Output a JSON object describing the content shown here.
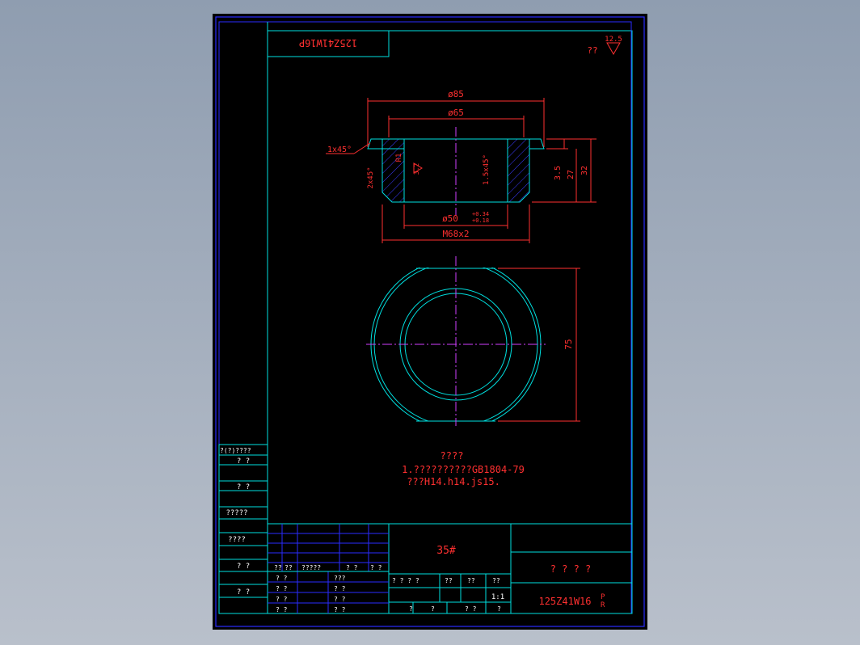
{
  "drawing_code_rotated": "125Z41W16P",
  "roughness": {
    "value": "12.5",
    "note": "??"
  },
  "dims": {
    "d85": "ø85",
    "d65": "ø65",
    "chamfer_top": "1x45°",
    "radius": "R1",
    "chamfer_left": "2x45°",
    "roughness_inner": "3.2",
    "chamfer_right": "1.5x45°",
    "h35": "3.5",
    "h27": "27",
    "h32": "32",
    "d50": "ø50",
    "d50_upper": "+0.34",
    "d50_lower": "+0.18",
    "thread": "M68x2",
    "d75": "75"
  },
  "notes": {
    "title": "????",
    "line1": "1.??????????GB1804-79",
    "line2": "???H14.h14.js15."
  },
  "left_strip": {
    "r1": "?(?)????",
    "r2": "? ?",
    "r3": "? ?",
    "r4": "?????",
    "r5": "????",
    "r6": "? ?",
    "r7": "? ?"
  },
  "title_block": {
    "material": "35#",
    "part_name": "? ? ? ?",
    "drawing_no": "125Z41W16",
    "drawing_suffix_top": "P",
    "drawing_suffix_bottom": "R",
    "scale": "1:1",
    "rev_row": [
      "??",
      "??",
      "?????",
      "? ?",
      "? ?"
    ],
    "sign_labels": [
      "? ?",
      "? ?",
      "? ?",
      "? ?"
    ],
    "sign_labels_2": [
      "???",
      "? ?",
      "? ?",
      "? ?"
    ],
    "stage_headers": [
      "? ? ? ?",
      "??",
      "??",
      "??"
    ],
    "sheet_row": [
      "?",
      "?",
      "? ?",
      "?"
    ]
  }
}
